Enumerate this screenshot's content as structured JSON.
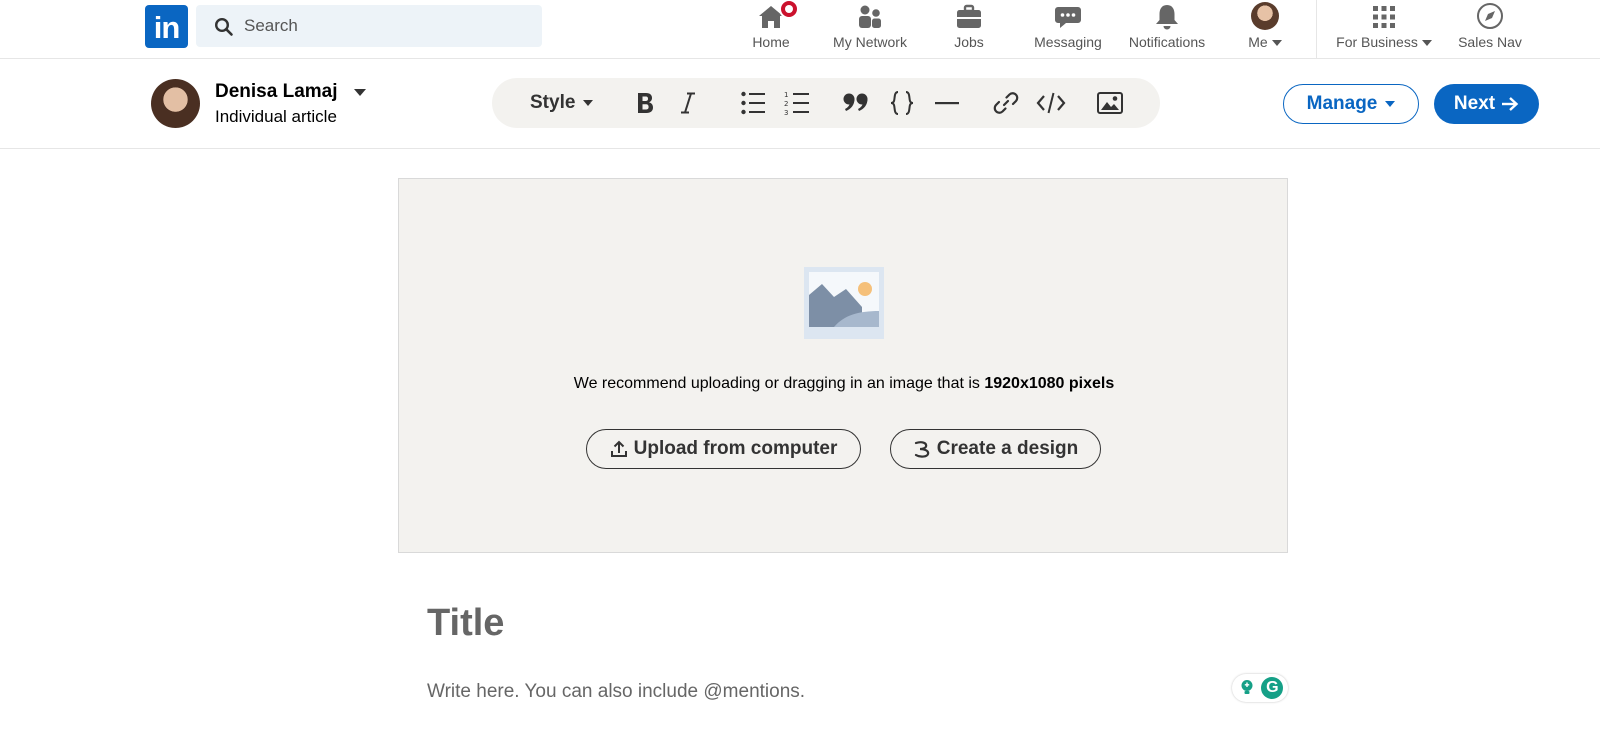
{
  "brand": {
    "logo_text": "in",
    "color": "#0a66c2"
  },
  "search": {
    "placeholder": "Search",
    "icon": "search-icon"
  },
  "nav": {
    "items": [
      {
        "label": "Home",
        "icon": "home-icon",
        "has_badge": true
      },
      {
        "label": "My Network",
        "icon": "network-icon"
      },
      {
        "label": "Jobs",
        "icon": "briefcase-icon"
      },
      {
        "label": "Messaging",
        "icon": "message-icon"
      },
      {
        "label": "Notifications",
        "icon": "bell-icon"
      },
      {
        "label": "Me",
        "icon": "avatar"
      },
      {
        "label": "For Business",
        "icon": "grid-icon"
      },
      {
        "label": "Sales Nav",
        "icon": "compass-icon"
      }
    ]
  },
  "editor": {
    "author_name": "Denisa Lamaj",
    "author_type": "Individual article",
    "toolbar": {
      "style_label": "Style",
      "buttons": [
        "bold-icon",
        "italic-icon",
        "bullet-list-icon",
        "numbered-list-icon",
        "quote-icon",
        "code-block-icon",
        "divider-icon",
        "link-icon",
        "embed-icon",
        "image-icon"
      ]
    },
    "manage_label": "Manage",
    "next_label": "Next"
  },
  "cover": {
    "recommend_text": "We recommend uploading or dragging in an image that is ",
    "recommend_size": "1920x1080 pixels",
    "upload_label": "Upload from computer",
    "design_label": "Create a design"
  },
  "article": {
    "title_placeholder": "Title",
    "body_placeholder": "Write here. You can also include @mentions."
  },
  "colors": {
    "accent": "#0a66c2",
    "badge": "#cb112d",
    "dropzone_bg": "#f3f2ef",
    "grammarly": "#15a087"
  }
}
